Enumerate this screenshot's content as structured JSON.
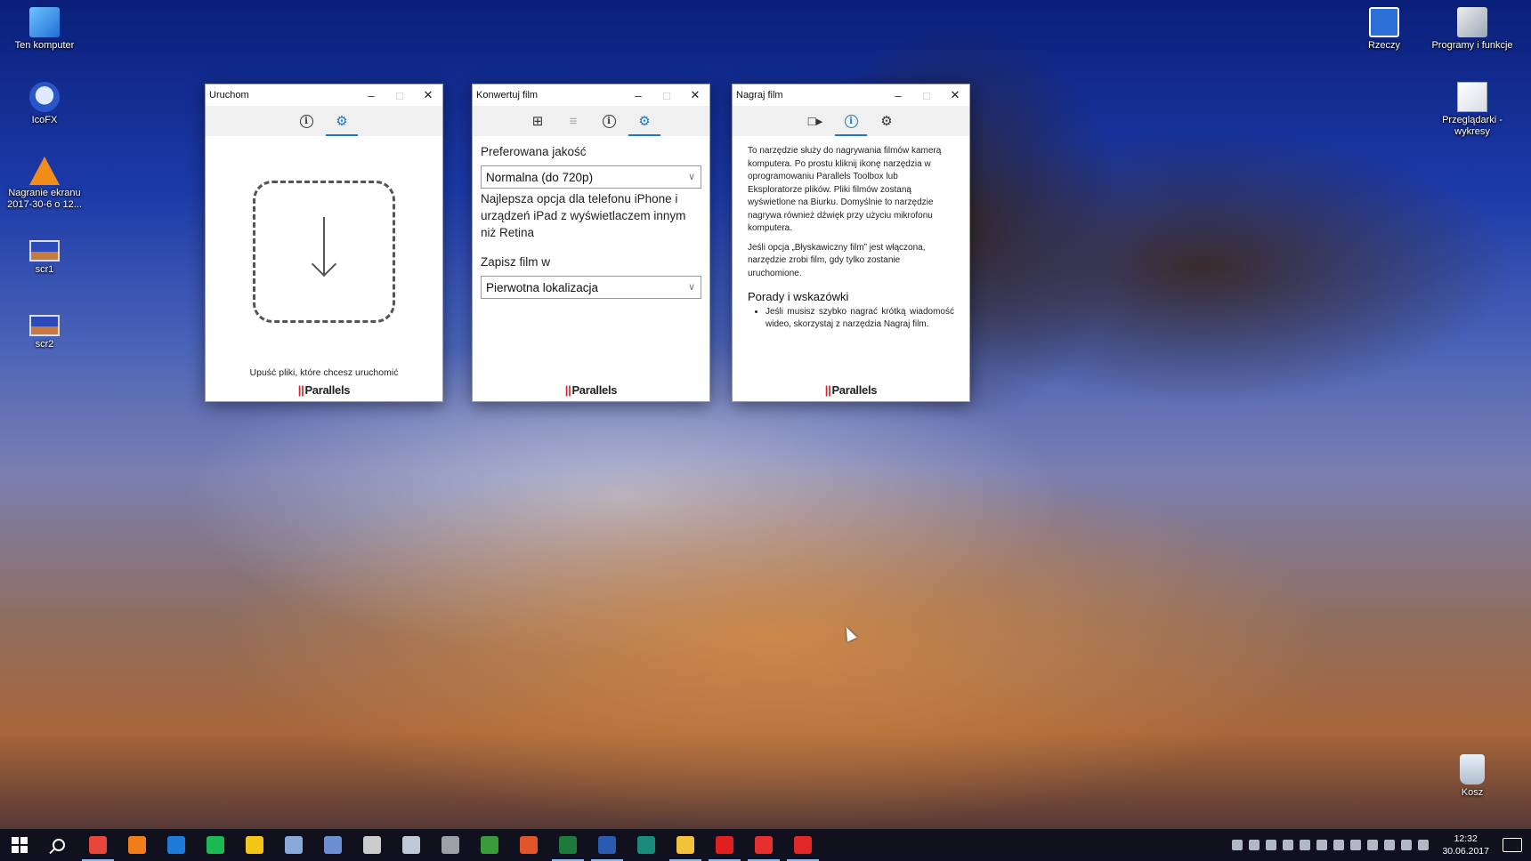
{
  "desktop": {
    "icons_left": [
      {
        "label": "Ten komputer",
        "icon": "computer-icon"
      },
      {
        "label": "IcoFX",
        "icon": "icofx-icon"
      },
      {
        "label": "Nagranie ekranu 2017-30-6 o 12...",
        "icon": "vlc-icon"
      },
      {
        "label": "scr1",
        "icon": "image-file-icon"
      },
      {
        "label": "scr2",
        "icon": "image-file-icon"
      }
    ],
    "icons_right": [
      {
        "label": "Rzeczy",
        "icon": "shortcut-icon"
      },
      {
        "label": "Programy i funkcje",
        "icon": "programs-icon"
      },
      {
        "label": "Przeglądarki - wykresy",
        "icon": "document-icon"
      },
      {
        "label": "Kosz",
        "icon": "recycle-bin-icon"
      }
    ]
  },
  "windows": {
    "run": {
      "title": "Uruchom",
      "drop_hint": "Upuść pliki, które chcesz uruchomić",
      "logo": "Parallels"
    },
    "convert": {
      "title": "Konwertuj film",
      "quality_label": "Preferowana jakość",
      "quality_value": "Normalna (do 720p)",
      "quality_desc": "Najlepsza opcja dla telefonu iPhone i urządzeń iPad z wyświetlaczem innym niż Retina",
      "save_label": "Zapisz film w",
      "save_value": "Pierwotna lokalizacja",
      "logo": "Parallels"
    },
    "record": {
      "title": "Nagraj film",
      "para1": "To narzędzie służy do nagrywania filmów kamerą komputera. Po prostu kliknij ikonę narzędzia w oprogramowaniu Parallels Toolbox lub Eksploratorze plików. Pliki filmów zostaną wyświetlone na Biurku. Domyślnie to narzędzie nagrywa również dźwięk przy użyciu mikrofonu komputera.",
      "para2": "Jeśli opcja „Błyskawiczny film” jest włączona, narzędzie zrobi film, gdy tylko zostanie uruchomione.",
      "tips_title": "Porady i wskazówki",
      "tip1": "Jeśli musisz szybko nagrać krótką wiadomość wideo, skorzystaj z narzędzia Nagraj film.",
      "logo": "Parallels"
    }
  },
  "taskbar": {
    "time": "12:32",
    "date": "30.06.2017",
    "apps": [
      {
        "name": "chrome-icon",
        "color": "#e8453c",
        "open": true
      },
      {
        "name": "firefox-icon",
        "color": "#f07d1a",
        "open": false
      },
      {
        "name": "edge-icon",
        "color": "#1e7bd8",
        "open": false
      },
      {
        "name": "spotify-icon",
        "color": "#1db954",
        "open": false
      },
      {
        "name": "keep-icon",
        "color": "#f5c518",
        "open": false
      },
      {
        "name": "virtualbox-icon",
        "color": "#8aa8d8",
        "open": false
      },
      {
        "name": "box-icon",
        "color": "#6b8fd0",
        "open": false
      },
      {
        "name": "lfx-icon",
        "color": "#cccccc",
        "open": false
      },
      {
        "name": "jar-icon",
        "color": "#bfc8d6",
        "open": false
      },
      {
        "name": "plane-icon",
        "color": "#9aa0a6",
        "open": false
      },
      {
        "name": "sheet-app-icon",
        "color": "#3a9b3a",
        "open": false
      },
      {
        "name": "office-icon",
        "color": "#e0552a",
        "open": false
      },
      {
        "name": "excel-icon",
        "color": "#1f7a3e",
        "open": true
      },
      {
        "name": "word-icon",
        "color": "#2b5bb0",
        "open": true
      },
      {
        "name": "sway-icon",
        "color": "#1a8a7a",
        "open": false
      },
      {
        "name": "explorer-icon",
        "color": "#f2c23a",
        "open": true
      },
      {
        "name": "opera-icon",
        "color": "#e02020",
        "open": true
      },
      {
        "name": "record-app-icon",
        "color": "#e63030",
        "open": true
      },
      {
        "name": "video-app-icon",
        "color": "#e02828",
        "open": true
      }
    ]
  }
}
